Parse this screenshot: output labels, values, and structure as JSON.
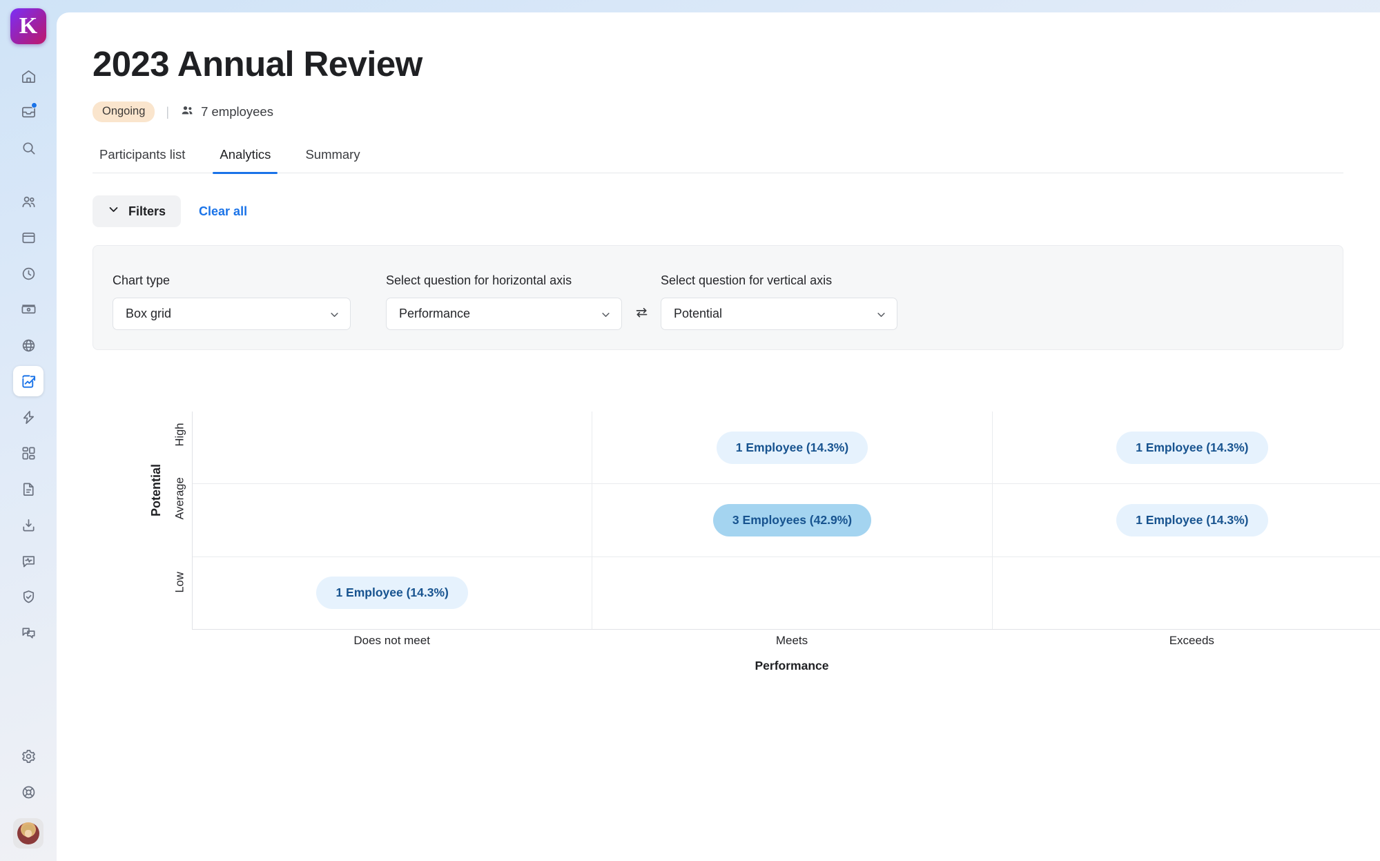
{
  "app": {
    "brand_initial": "K"
  },
  "sidebar": {
    "items": [
      {
        "name": "home-icon",
        "label": "Home"
      },
      {
        "name": "inbox-icon",
        "label": "Inbox",
        "badge": true
      },
      {
        "name": "search-icon",
        "label": "Search"
      },
      {
        "name": "people-icon",
        "label": "People"
      },
      {
        "name": "calendar-icon",
        "label": "Calendar"
      },
      {
        "name": "time-tracking-icon",
        "label": "Time tracking"
      },
      {
        "name": "payroll-icon",
        "label": "Payroll"
      },
      {
        "name": "globe-icon",
        "label": "Global"
      },
      {
        "name": "performance-chart-icon",
        "label": "Performance",
        "active": true
      },
      {
        "name": "automation-bolt-icon",
        "label": "Automations"
      },
      {
        "name": "apps-grid-icon",
        "label": "Apps"
      },
      {
        "name": "documents-icon",
        "label": "Documents"
      },
      {
        "name": "import-download-icon",
        "label": "Imports"
      },
      {
        "name": "insights-pulse-icon",
        "label": "Insights"
      },
      {
        "name": "shield-check-icon",
        "label": "Compliance"
      },
      {
        "name": "chat-bubbles-icon",
        "label": "Messages"
      }
    ],
    "bottom_items": [
      {
        "name": "gear-icon",
        "label": "Settings"
      },
      {
        "name": "lifebuoy-help-icon",
        "label": "Help"
      }
    ],
    "avatar_label": "User profile"
  },
  "header": {
    "title": "2023 Annual Review",
    "status_badge": "Ongoing",
    "separator": "|",
    "employees_count": "7 employees"
  },
  "tabs": [
    {
      "label": "Participants list",
      "active": false
    },
    {
      "label": "Analytics",
      "active": true
    },
    {
      "label": "Summary",
      "active": false
    }
  ],
  "filters": {
    "button_label": "Filters",
    "clear_all_label": "Clear all"
  },
  "controls": {
    "chart_type": {
      "label": "Chart type",
      "value": "Box grid"
    },
    "horizontal_axis": {
      "label": "Select question for horizontal axis",
      "value": "Performance"
    },
    "vertical_axis": {
      "label": "Select question for vertical axis",
      "value": "Potential"
    },
    "swap_label": "Swap axes"
  },
  "chart_data": {
    "type": "heatmap",
    "title": "",
    "xlabel": "Performance",
    "ylabel": "Potential",
    "categories": [
      "Does not meet",
      "Meets",
      "Exceeds"
    ],
    "y_categories": [
      "High",
      "Average",
      "Low"
    ],
    "grid": true,
    "legend": "none",
    "total_employees": 7,
    "cells": [
      {
        "row": "High",
        "col": "Does not meet",
        "count": 0,
        "percent": 0.0,
        "label": "",
        "highlight": false
      },
      {
        "row": "High",
        "col": "Meets",
        "count": 1,
        "percent": 14.3,
        "label": "1 Employee (14.3%)",
        "highlight": false
      },
      {
        "row": "High",
        "col": "Exceeds",
        "count": 1,
        "percent": 14.3,
        "label": "1 Employee (14.3%)",
        "highlight": false
      },
      {
        "row": "Average",
        "col": "Does not meet",
        "count": 0,
        "percent": 0.0,
        "label": "",
        "highlight": false
      },
      {
        "row": "Average",
        "col": "Meets",
        "count": 3,
        "percent": 42.9,
        "label": "3 Employees (42.9%)",
        "highlight": true
      },
      {
        "row": "Average",
        "col": "Exceeds",
        "count": 1,
        "percent": 14.3,
        "label": "1 Employee (14.3%)",
        "highlight": false
      },
      {
        "row": "Low",
        "col": "Does not meet",
        "count": 1,
        "percent": 14.3,
        "label": "1 Employee (14.3%)",
        "highlight": false
      },
      {
        "row": "Low",
        "col": "Meets",
        "count": 0,
        "percent": 0.0,
        "label": "",
        "highlight": false
      },
      {
        "row": "Low",
        "col": "Exceeds",
        "count": 0,
        "percent": 0.0,
        "label": "",
        "highlight": false
      }
    ],
    "colors": {
      "pill_light": "#e6f2fd",
      "pill_strong": "#a4d4f0",
      "pill_text": "#17538f",
      "grid_line": "#e9ebee"
    }
  },
  "theme": {
    "accent": "#1a73e8",
    "badge_bg": "#fae5cd",
    "panel_bg": "#f6f7f8"
  }
}
